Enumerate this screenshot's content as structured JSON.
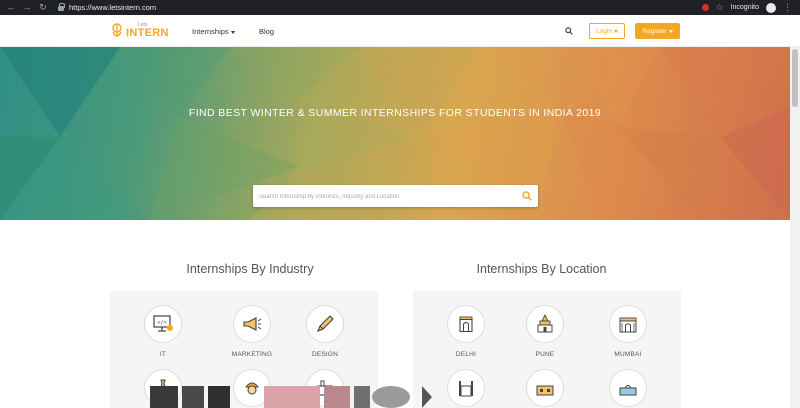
{
  "browser": {
    "url": "https://www.letsintern.com",
    "profile_label": "Incognito"
  },
  "header": {
    "logo_small": "Lets",
    "logo_main": "INTERN",
    "nav": [
      {
        "label": "Internships",
        "has_dropdown": true
      },
      {
        "label": "Blog",
        "has_dropdown": false
      }
    ],
    "login_label": "Login",
    "register_label": "Register"
  },
  "hero": {
    "title": "FIND BEST WINTER & SUMMER INTERNSHIPS FOR STUDENTS IN INDIA 2019",
    "search_placeholder": "Search Internship by Interests, Industry and Location"
  },
  "industry": {
    "title": "Internships By Industry",
    "items": [
      {
        "label": "IT",
        "icon": "code-monitor-icon"
      },
      {
        "label": "MARKETING",
        "icon": "megaphone-icon"
      },
      {
        "label": "DESIGN",
        "icon": "pen-icon"
      },
      {
        "label": "",
        "icon": "tie-icon"
      },
      {
        "label": "",
        "icon": "worker-icon"
      },
      {
        "label": "",
        "icon": "industry-icon"
      }
    ]
  },
  "location": {
    "title": "Internships By Location",
    "items": [
      {
        "label": "DELHI",
        "icon": "india-gate-icon"
      },
      {
        "label": "PUNE",
        "icon": "temple-icon"
      },
      {
        "label": "MUMBAI",
        "icon": "gateway-icon"
      },
      {
        "label": "",
        "icon": "charminar-icon"
      },
      {
        "label": "",
        "icon": "palace-icon"
      },
      {
        "label": "",
        "icon": "building-icon"
      }
    ]
  },
  "colors": {
    "accent": "#f5a623",
    "chrome_bg": "#202124",
    "panel_bg": "#f5f5f5"
  }
}
